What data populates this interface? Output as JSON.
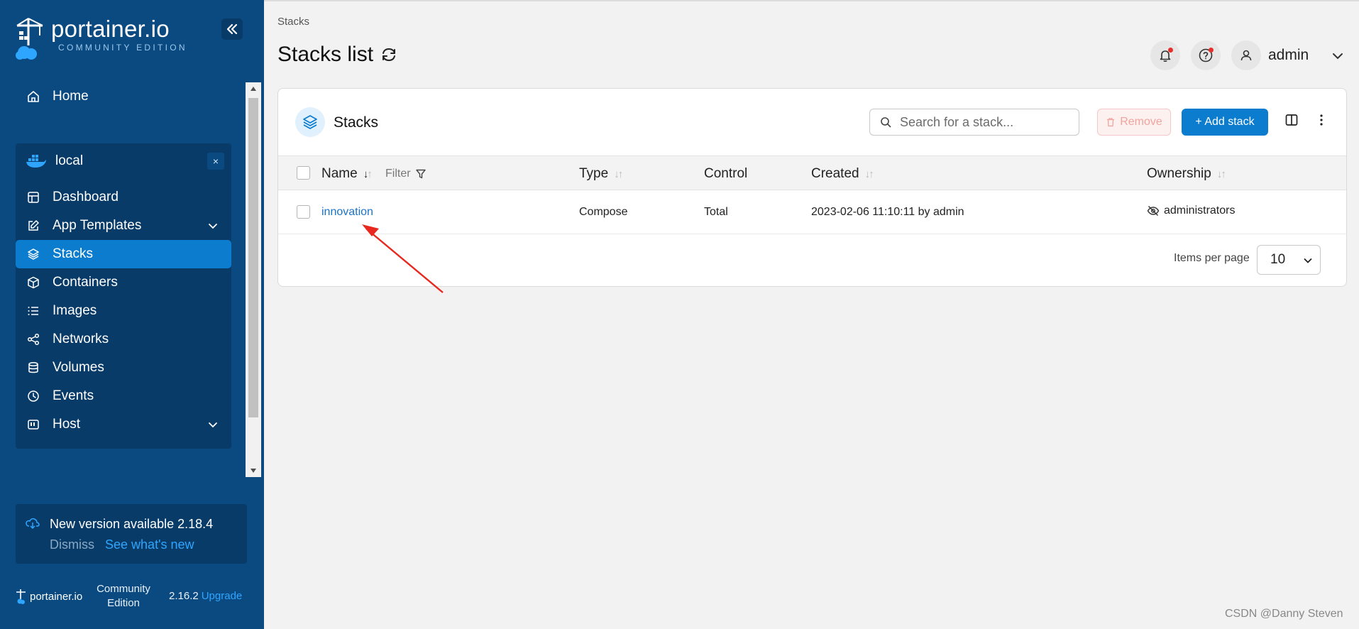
{
  "sidebar": {
    "logo_main": "portainer.io",
    "logo_sub": "COMMUNITY EDITION",
    "home_label": "Home",
    "environment": {
      "name": "local",
      "close": "×",
      "items": [
        {
          "label": "Dashboard",
          "icon": "dashboard-icon"
        },
        {
          "label": "App Templates",
          "icon": "edit-icon",
          "expandable": true
        },
        {
          "label": "Stacks",
          "icon": "layers-icon",
          "active": true
        },
        {
          "label": "Containers",
          "icon": "box-icon"
        },
        {
          "label": "Images",
          "icon": "list-icon"
        },
        {
          "label": "Networks",
          "icon": "share-icon"
        },
        {
          "label": "Volumes",
          "icon": "database-icon"
        },
        {
          "label": "Events",
          "icon": "clock-icon"
        },
        {
          "label": "Host",
          "icon": "server-icon",
          "expandable": true
        }
      ]
    },
    "update": {
      "title": "New version available 2.18.4",
      "dismiss": "Dismiss",
      "whats_new": "See what's new"
    },
    "footer": {
      "logo_text": "portainer.io",
      "edition": "Community Edition",
      "version": "2.16.2",
      "upgrade": "Upgrade"
    }
  },
  "header": {
    "breadcrumb": "Stacks",
    "title": "Stacks list",
    "user": "admin"
  },
  "card": {
    "title": "Stacks",
    "search_placeholder": "Search for a stack...",
    "remove_label": "Remove",
    "add_label": "+ Add stack",
    "filter_label": "Filter",
    "columns": {
      "name": "Name",
      "type": "Type",
      "control": "Control",
      "created": "Created",
      "ownership": "Ownership"
    },
    "rows": [
      {
        "name": "innovation",
        "type": "Compose",
        "control": "Total",
        "created": "2023-02-06 11:10:11 by admin",
        "ownership": "administrators"
      }
    ],
    "items_per_page_label": "Items per page",
    "items_per_page_value": "10"
  },
  "colors": {
    "sidebar_bg": "#0b4a80",
    "sidebar_panel": "#083b68",
    "accent": "#0c7ccf",
    "link": "#1a73c8",
    "annotation_arrow": "#e8281e"
  },
  "watermark": "CSDN @Danny Steven"
}
